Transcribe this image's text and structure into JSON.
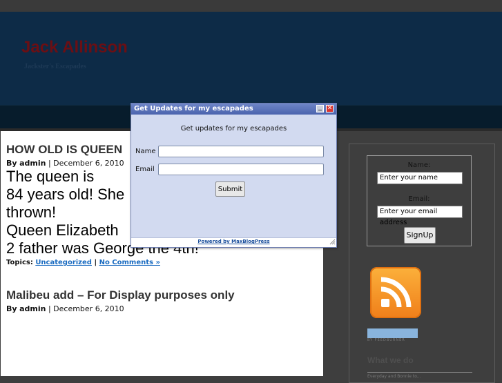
{
  "site": {
    "title": "Jack Allinson",
    "tagline": "Jackster's Escapades"
  },
  "posts": [
    {
      "title": "HOW OLD IS QUEEN",
      "author_prefix": "By",
      "author": "admin",
      "date": "December 6, 2010",
      "body_lines": [
        "The queen is",
        "84 years old! She",
        "thrown!",
        "Queen Elizabeth",
        "2 father  was George the 4th!"
      ],
      "topics_label": "Topics:",
      "category": "Uncategorized",
      "separator": "|",
      "comments": "No Comments »"
    },
    {
      "title": "Malibeu add – For Display purposes only",
      "author_prefix": "By",
      "author": "admin",
      "date": "December 6, 2010"
    }
  ],
  "sidebar": {
    "signup": {
      "name_label": "Name:",
      "name_value": "Enter your name",
      "email_label": "Email:",
      "email_value": "Enter your email address",
      "button": "SignUp"
    },
    "rss_icon": "rss-feed-icon",
    "feedburner_text": "BY FEEDBURNER",
    "what_we_do_title": "What we do",
    "what_we_do_text": "Everyday and Bonnie to..."
  },
  "popup": {
    "title": "Get Updates for my escapades",
    "heading": "Get updates for my escapades",
    "name_label": "Name",
    "email_label": "Email",
    "submit": "Submit",
    "powered_by": "Powered by MaxBlogPress",
    "close_glyph": "✕",
    "colors": {
      "titlebar": "#4a63ad",
      "body": "#d2daf0"
    }
  },
  "colors": {
    "header": "#0d2b47",
    "site_title": "#6b0f14",
    "link": "#1a6bc0",
    "page_bg": "#3e3e3e"
  }
}
